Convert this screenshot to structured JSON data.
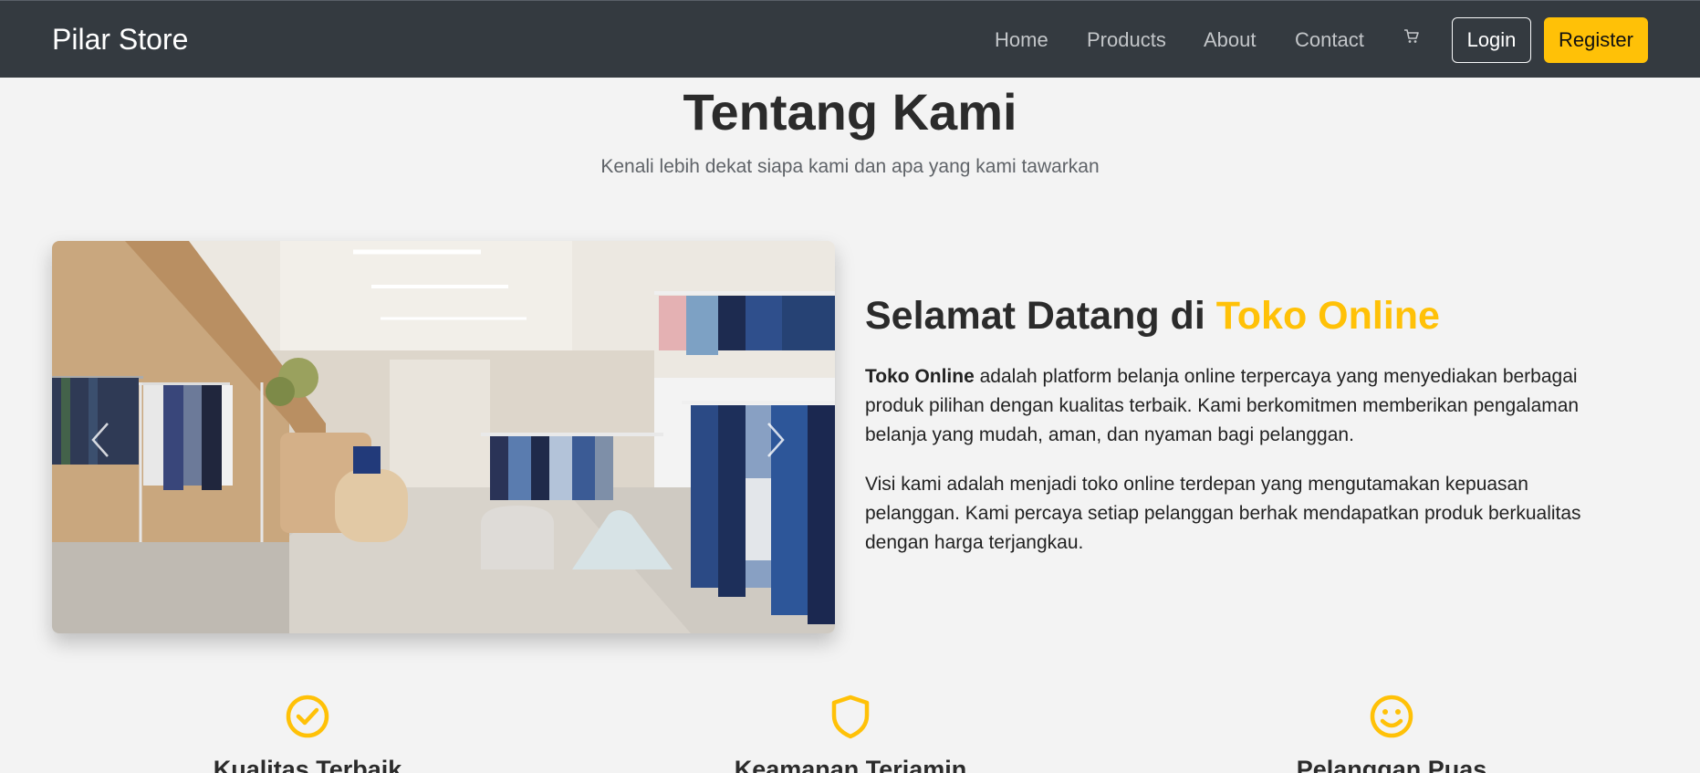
{
  "nav": {
    "brand": "Pilar Store",
    "links": [
      "Home",
      "Products",
      "About",
      "Contact"
    ],
    "login_label": "Login",
    "register_label": "Register",
    "cart_icon": "cart-icon"
  },
  "hero": {
    "title": "Tentang Kami",
    "subtitle": "Kenali lebih dekat siapa kami dan apa yang kami tawarkan"
  },
  "about": {
    "heading_prefix": "Selamat Datang di ",
    "heading_accent": "Toko Online",
    "para1_bold": "Toko Online",
    "para1_rest": " adalah platform belanja online terpercaya yang menyediakan berbagai produk pilihan dengan kualitas terbaik. Kami berkomitmen memberikan pengalaman belanja yang mudah, aman, dan nyaman bagi pelanggan.",
    "para2": "Visi kami adalah menjadi toko online terdepan yang mengutamakan kepuasan pelanggan. Kami percaya setiap pelanggan berhak mendapatkan produk berkualitas dengan harga terjangkau."
  },
  "features": [
    {
      "icon": "check-circle-icon",
      "title": "Kualitas Terbaik"
    },
    {
      "icon": "shield-icon",
      "title": "Keamanan Terjamin"
    },
    {
      "icon": "smile-icon",
      "title": "Pelanggan Puas"
    }
  ],
  "colors": {
    "navbar": "#343a40",
    "accent": "#ffc107",
    "background": "#f3f3f3"
  }
}
